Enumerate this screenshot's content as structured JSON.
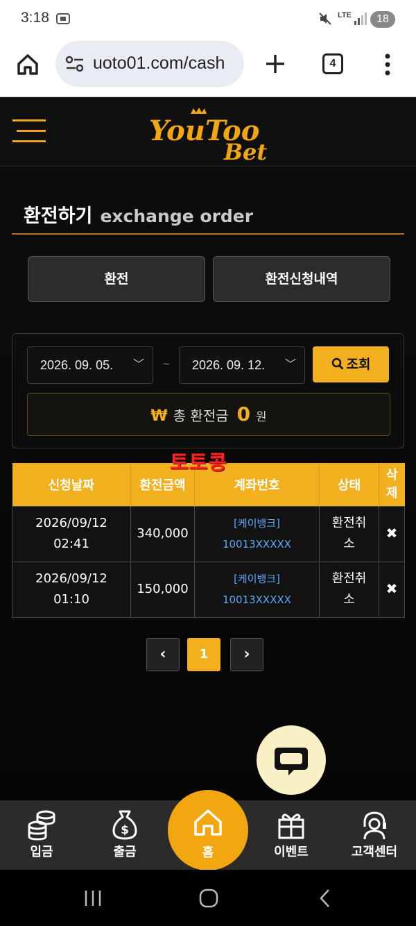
{
  "status_bar": {
    "time": "3:18",
    "network": "LTE",
    "battery": "18"
  },
  "browser": {
    "url": "uoto01.com/cash",
    "tab_count": "4"
  },
  "page": {
    "title_ko": "환전하기",
    "title_en": "exchange order",
    "tab_exchange": "환전",
    "tab_history": "환전신청내역"
  },
  "filter": {
    "date_from": "2026. 09. 05.",
    "date_to": "2026. 09. 12.",
    "separator": "~",
    "search_label": "조회",
    "total_icon": "₩",
    "total_label": "총 환전금",
    "total_amount": "0",
    "total_unit": "원"
  },
  "watermark": "토토콩",
  "table": {
    "headers": [
      "신청날짜",
      "환전금액",
      "계좌번호",
      "상태",
      "삭제"
    ],
    "rows": [
      {
        "date": "2026/09/12",
        "time": "02:41",
        "amount": "340,000",
        "bank": "[케이뱅크]",
        "account": "10013XXXXX",
        "status": "환전취소",
        "delete": "✖"
      },
      {
        "date": "2026/09/12",
        "time": "01:10",
        "amount": "150,000",
        "bank": "[케이뱅크]",
        "account": "10013XXXXX",
        "status": "환전취소",
        "delete": "✖"
      }
    ]
  },
  "pagination": {
    "prev": "‹",
    "current": "1",
    "next": "›"
  },
  "bottom_nav": {
    "deposit": "입금",
    "withdraw": "출금",
    "home": "홈",
    "event": "이벤트",
    "support": "고객센터"
  },
  "colors": {
    "accent": "#f2b01e",
    "background": "#0a0a0a",
    "link": "#5da8ff",
    "watermark": "#ff2222"
  }
}
